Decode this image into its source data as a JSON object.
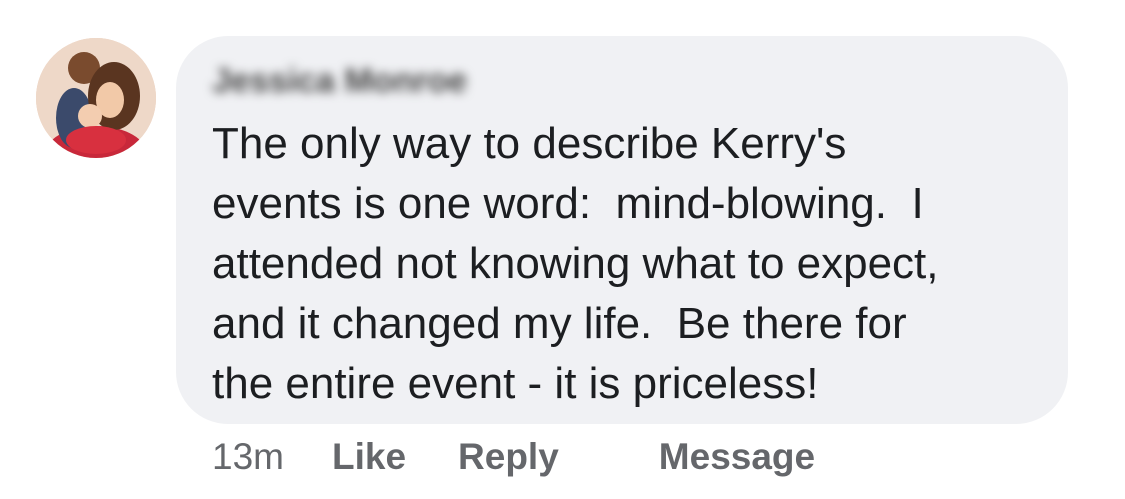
{
  "comment": {
    "author": "Jessica Monroe",
    "lines": [
      "The only way to describe Kerry's",
      "events is one word:  mind-blowing.  I",
      "attended not knowing what to expect,",
      "and it changed my life.  Be there for",
      "the entire event - it is priceless!"
    ],
    "timestamp": "13m",
    "actions": {
      "like": "Like",
      "reply": "Reply",
      "message": "Message"
    }
  }
}
